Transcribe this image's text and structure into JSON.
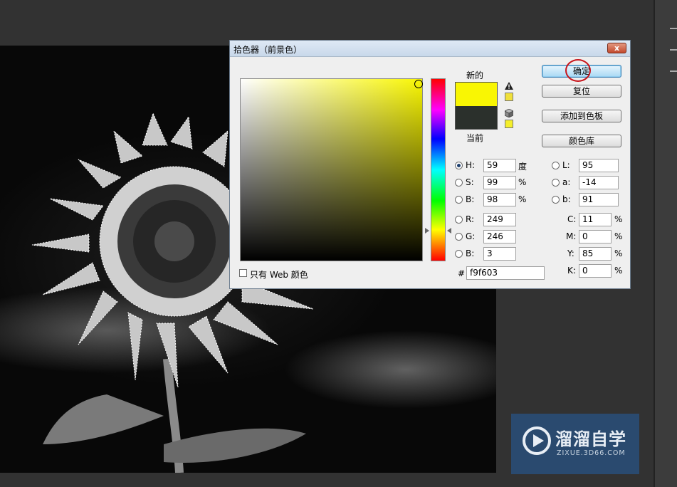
{
  "dialog": {
    "title": "拾色器（前景色）",
    "close_label": "x",
    "new_label": "新的",
    "current_label": "当前",
    "new_color": "#f9f603",
    "current_color": "#2b302c",
    "ok_label": "确定",
    "reset_label": "复位",
    "add_swatch_label": "添加到色板",
    "color_library_label": "颜色库",
    "hsb": [
      {
        "label": "H:",
        "value": "59",
        "unit": "度"
      },
      {
        "label": "S:",
        "value": "99",
        "unit": "%"
      },
      {
        "label": "B:",
        "value": "98",
        "unit": "%"
      }
    ],
    "rgb": [
      {
        "label": "R:",
        "value": "249"
      },
      {
        "label": "G:",
        "value": "246"
      },
      {
        "label": "B:",
        "value": "3"
      }
    ],
    "lab": [
      {
        "label": "L:",
        "value": "95"
      },
      {
        "label": "a:",
        "value": "-14"
      },
      {
        "label": "b:",
        "value": "91"
      }
    ],
    "cmyk": [
      {
        "label": "C:",
        "value": "11",
        "unit": "%"
      },
      {
        "label": "M:",
        "value": "0",
        "unit": "%"
      },
      {
        "label": "Y:",
        "value": "85",
        "unit": "%"
      },
      {
        "label": "K:",
        "value": "0",
        "unit": "%"
      }
    ],
    "hex_label": "#",
    "hex_value": "f9f603",
    "web_only_label": "只有 Web 颜色",
    "web_only_checked": false
  },
  "watermark": {
    "title": "溜溜自学",
    "subtitle": "ZIXUE.3D66.COM"
  },
  "icons": [
    "warning-icon",
    "web-cube-icon",
    "close-icon",
    "play-logo-icon"
  ]
}
